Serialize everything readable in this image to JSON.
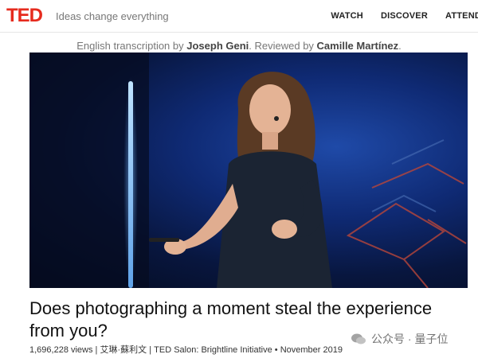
{
  "nav": {
    "logo": "TED",
    "tagline": "Ideas change everything",
    "links": [
      "WATCH",
      "DISCOVER",
      "ATTEND"
    ]
  },
  "credit": {
    "prefix": "English transcription by ",
    "transcriber": "Joseph Geni",
    "middle": ". Reviewed by ",
    "reviewer": "Camille Martínez",
    "suffix": "."
  },
  "talk": {
    "title": "Does photographing a moment steal the experience from you?",
    "views": "1,696,228 views",
    "speaker": "艾琳·蘇利文",
    "event": "TED Salon: Brightline Initiative",
    "date": "November 2019",
    "sep1": " | ",
    "sep2": " | ",
    "sep3": " • "
  },
  "watermark": {
    "text": "公众号 · 量子位"
  },
  "colors": {
    "brand": "#e62b1e",
    "stage_blue": "#1f4aa8"
  }
}
